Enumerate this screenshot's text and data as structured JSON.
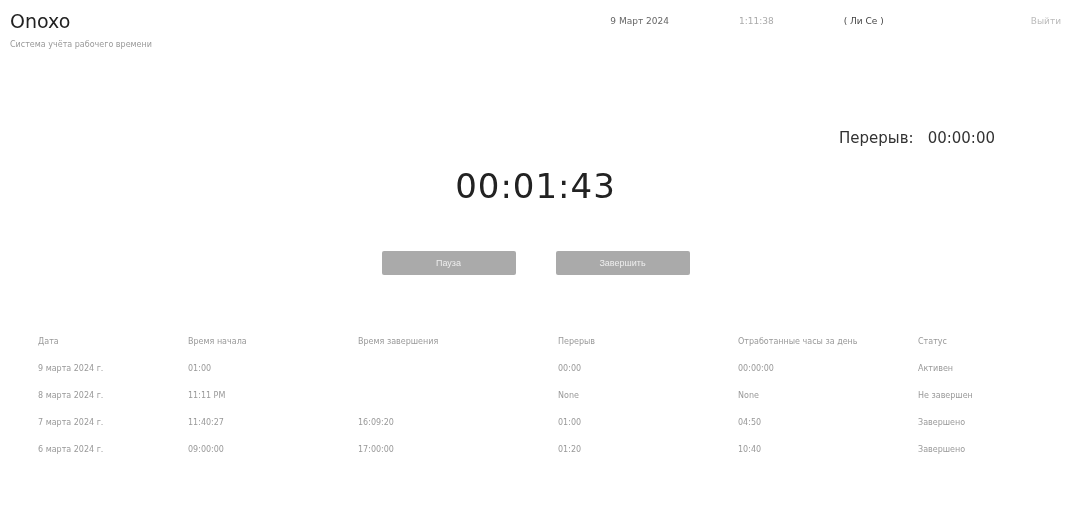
{
  "header": {
    "logo": "Onoxo",
    "subtitle": "Система учёта рабочего времени",
    "date": "9 Март 2024",
    "time": "1:11:38",
    "user": "( Ли Се )",
    "logout": "Выйти"
  },
  "break": {
    "label": "Перерыв:",
    "value": "00:00:00"
  },
  "timer": "00:01:43",
  "buttons": [
    {
      "label": "Пауза"
    },
    {
      "label": "Завершить"
    }
  ],
  "table": {
    "columns": [
      "Дата",
      "Время начала",
      "Время завершения",
      "Перерыв",
      "Отработанные часы за день",
      "Статус"
    ],
    "rows": [
      [
        "9 марта 2024 г.",
        "01:00",
        "",
        "00:00",
        "00:00:00",
        "Активен"
      ],
      [
        "8 марта 2024 г.",
        "11:11 PM",
        "",
        "None",
        "None",
        "Не завершен"
      ],
      [
        "7 марта 2024 г.",
        "11:40:27",
        "16:09:20",
        "01:00",
        "04:50",
        "Завершено"
      ],
      [
        "6 марта 2024 г.",
        "09:00:00",
        "17:00:00",
        "01:20",
        "10:40",
        "Завершено"
      ]
    ]
  }
}
